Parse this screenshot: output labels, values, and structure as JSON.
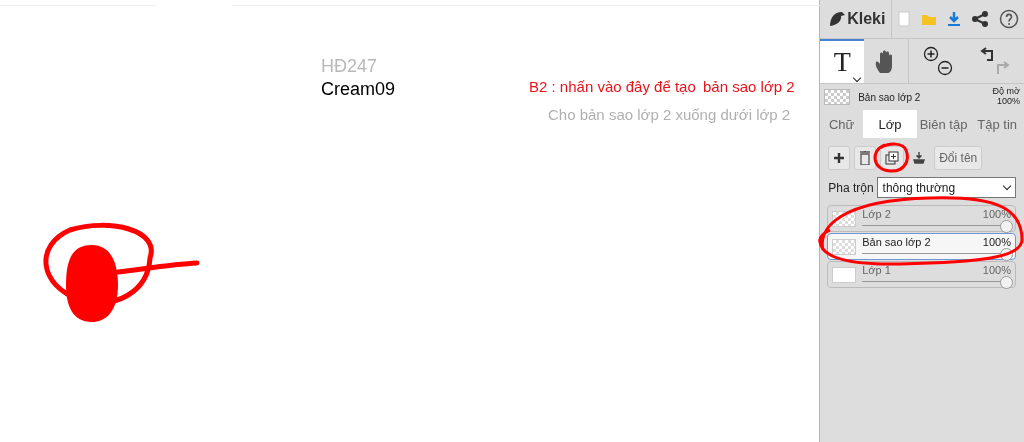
{
  "canvas": {
    "texts": [
      {
        "text": "HĐ247",
        "color": "#b8b8b8"
      },
      {
        "text": "Cream09",
        "color": "#000000"
      },
      {
        "text": "B2 : nhấn vào đây để tạo",
        "color": "#e8141c"
      },
      {
        "text": "bản sao lớp 2",
        "color": "#e8141c"
      },
      {
        "text": "Cho bản sao lớp 2 xuống dưới lớp 2",
        "color": "#b0b0b0"
      }
    ]
  },
  "panel": {
    "logo": "Kleki",
    "tools": [
      {
        "kind": "text",
        "label": "T",
        "selected": true
      },
      {
        "kind": "hand",
        "selected": false
      }
    ],
    "current_layer": {
      "name": "Bản sao lớp 2",
      "opacity_label": "Độ mờ",
      "opacity": "100%"
    },
    "tabs": [
      {
        "label": "Chữ",
        "selected": false
      },
      {
        "label": "Lớp",
        "selected": true
      },
      {
        "label": "Biên tập",
        "selected": false
      },
      {
        "label": "Tập tin",
        "selected": false
      }
    ],
    "rename_button": "Đổi tên",
    "blend": {
      "label": "Pha trộn",
      "value": "thông thường"
    },
    "layers": [
      {
        "name": "Lớp 2",
        "opacity": "100%",
        "level": 1,
        "selected": false,
        "transparent": true
      },
      {
        "name": "Bản sao lớp 2",
        "opacity": "100%",
        "level": 1,
        "selected": true,
        "transparent": true
      },
      {
        "name": "Lớp 1",
        "opacity": "100%",
        "level": 1,
        "selected": false,
        "transparent": false
      }
    ]
  }
}
